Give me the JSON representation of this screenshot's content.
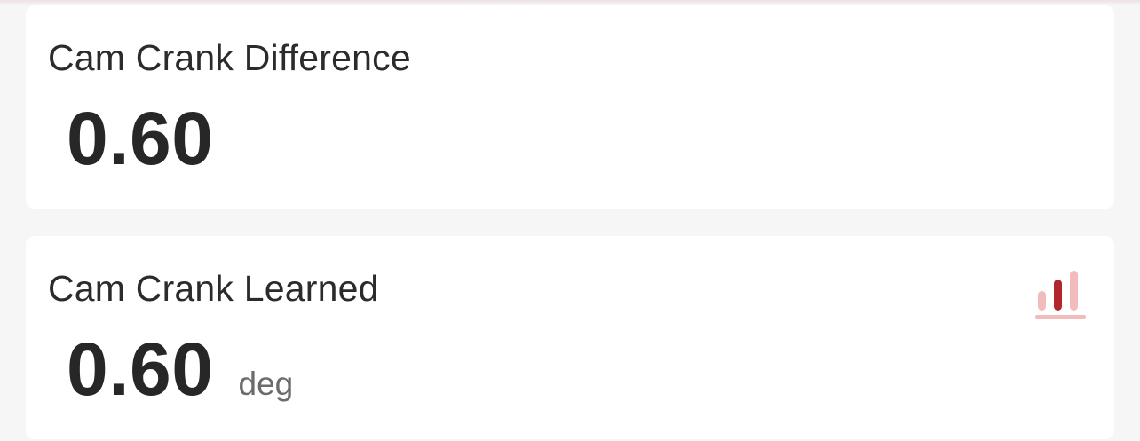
{
  "cards": [
    {
      "title": "Cam Crank Difference",
      "value": "0.60",
      "unit": ""
    },
    {
      "title": "Cam Crank Learned",
      "value": "0.60",
      "unit": "deg",
      "icon": "bar-chart-icon"
    }
  ],
  "colors": {
    "background": "#f6f6f6",
    "card": "#ffffff",
    "icon_accent": "#b2272b",
    "icon_light": "#f2bcbc"
  }
}
